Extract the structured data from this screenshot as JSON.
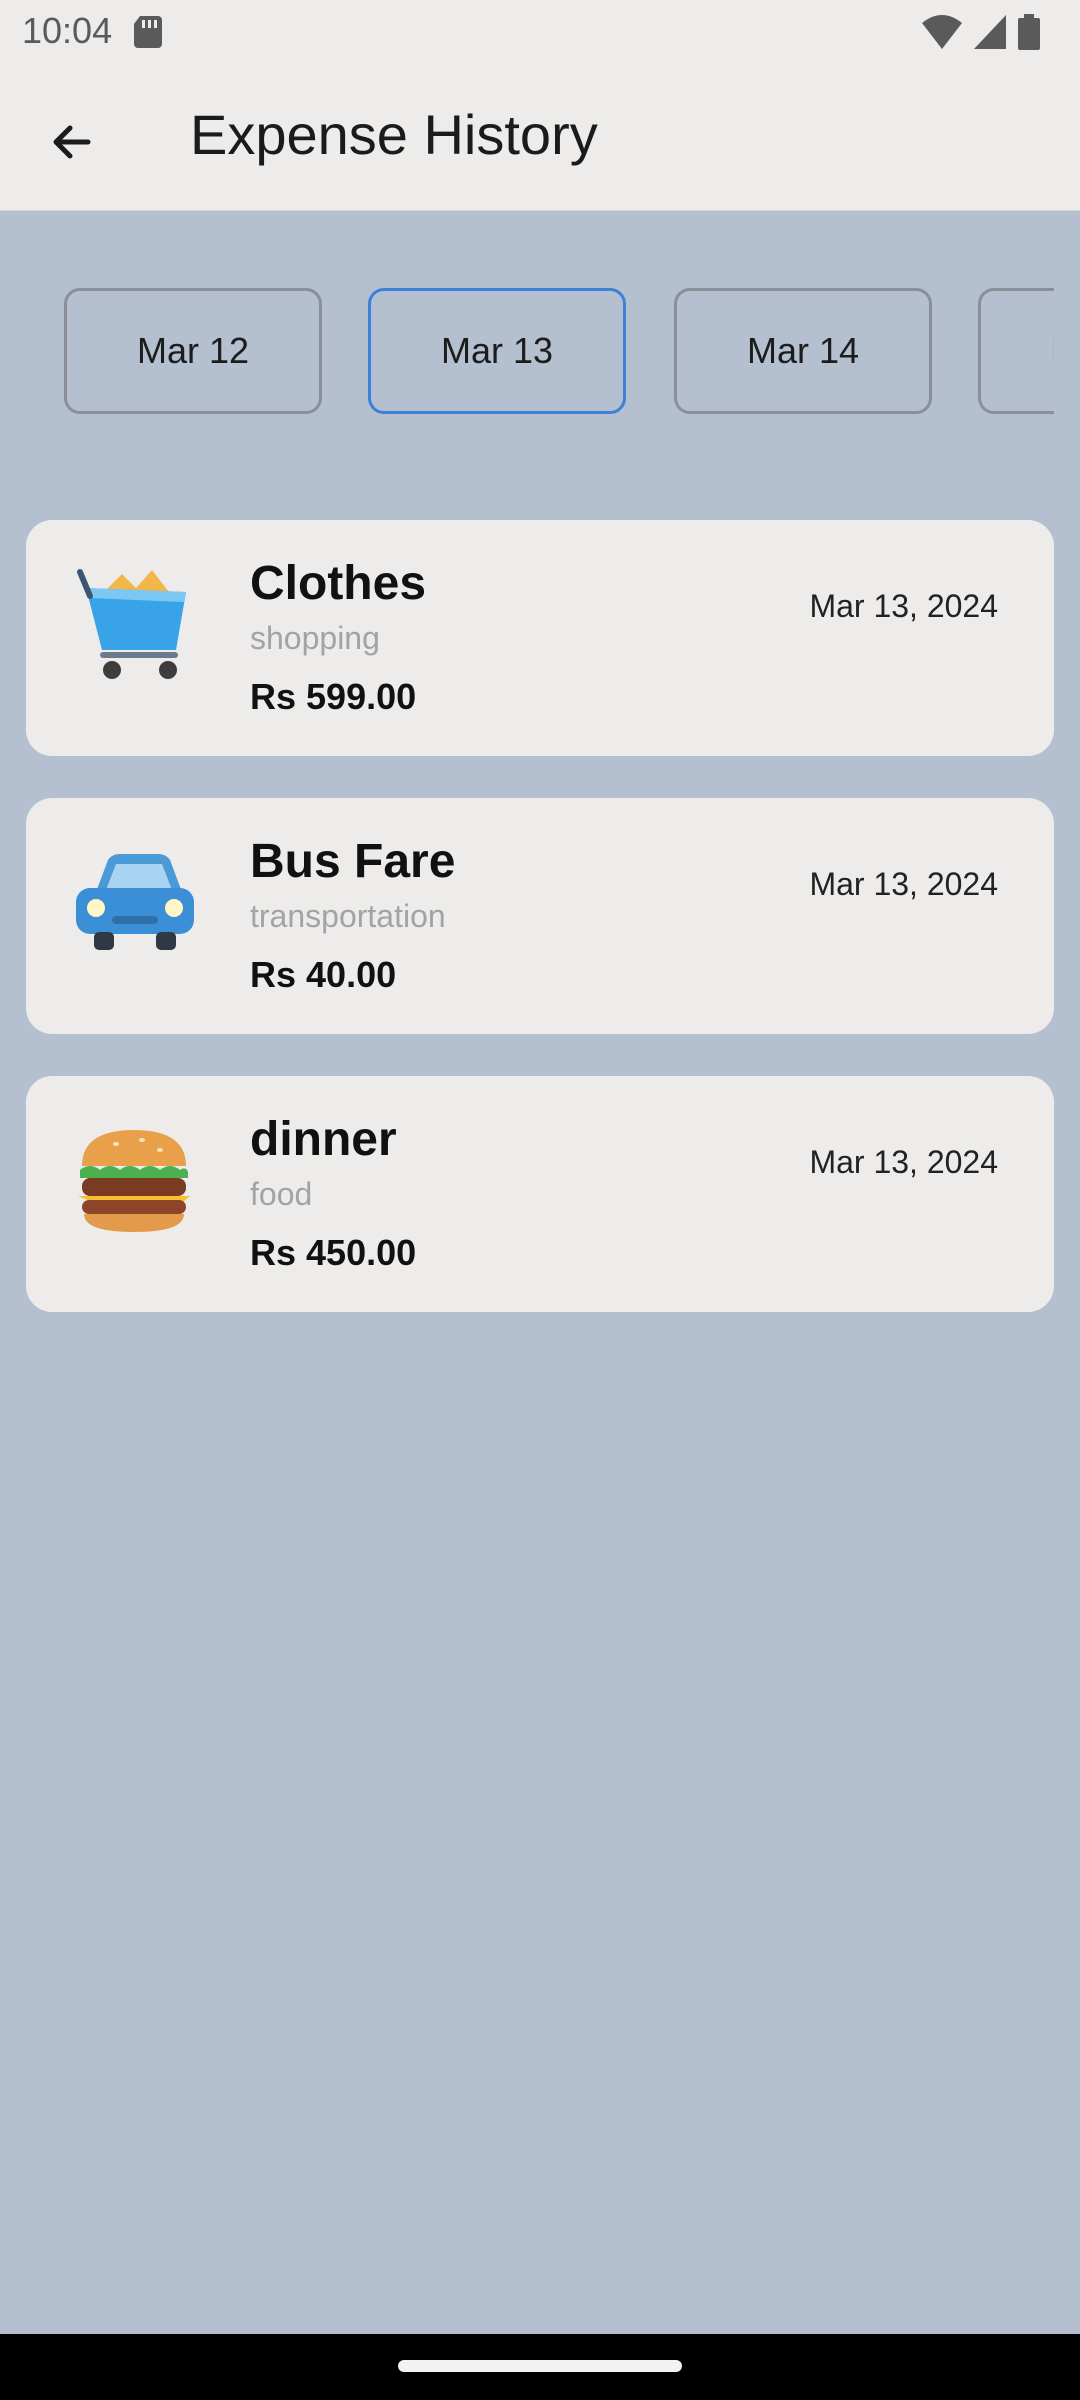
{
  "status_bar": {
    "time": "10:04",
    "icons": [
      "sd-card-icon",
      "wifi-icon",
      "signal-icon",
      "battery-icon"
    ]
  },
  "app_bar": {
    "title": "Expense History",
    "back_icon": "arrow-left-icon"
  },
  "date_selector": {
    "selected": "Mar 13",
    "chips": [
      {
        "label": "Mar 12"
      },
      {
        "label": "Mar 13"
      },
      {
        "label": "Mar 14"
      },
      {
        "label": "M"
      }
    ]
  },
  "expenses": [
    {
      "title": "Clothes",
      "category": "shopping",
      "amount": "Rs 599.00",
      "date": "Mar 13, 2024",
      "icon": "shopping-cart-icon"
    },
    {
      "title": "Bus Fare",
      "category": "transportation",
      "amount": "Rs 40.00",
      "date": "Mar 13, 2024",
      "icon": "car-icon"
    },
    {
      "title": "dinner",
      "category": "food",
      "amount": "Rs 450.00",
      "date": "Mar 13, 2024",
      "icon": "burger-icon"
    }
  ],
  "colors": {
    "background": "#b4bfcf",
    "surface": "#edeceb",
    "selected_border": "#3b82d8",
    "chip_border": "#8a8f99"
  }
}
